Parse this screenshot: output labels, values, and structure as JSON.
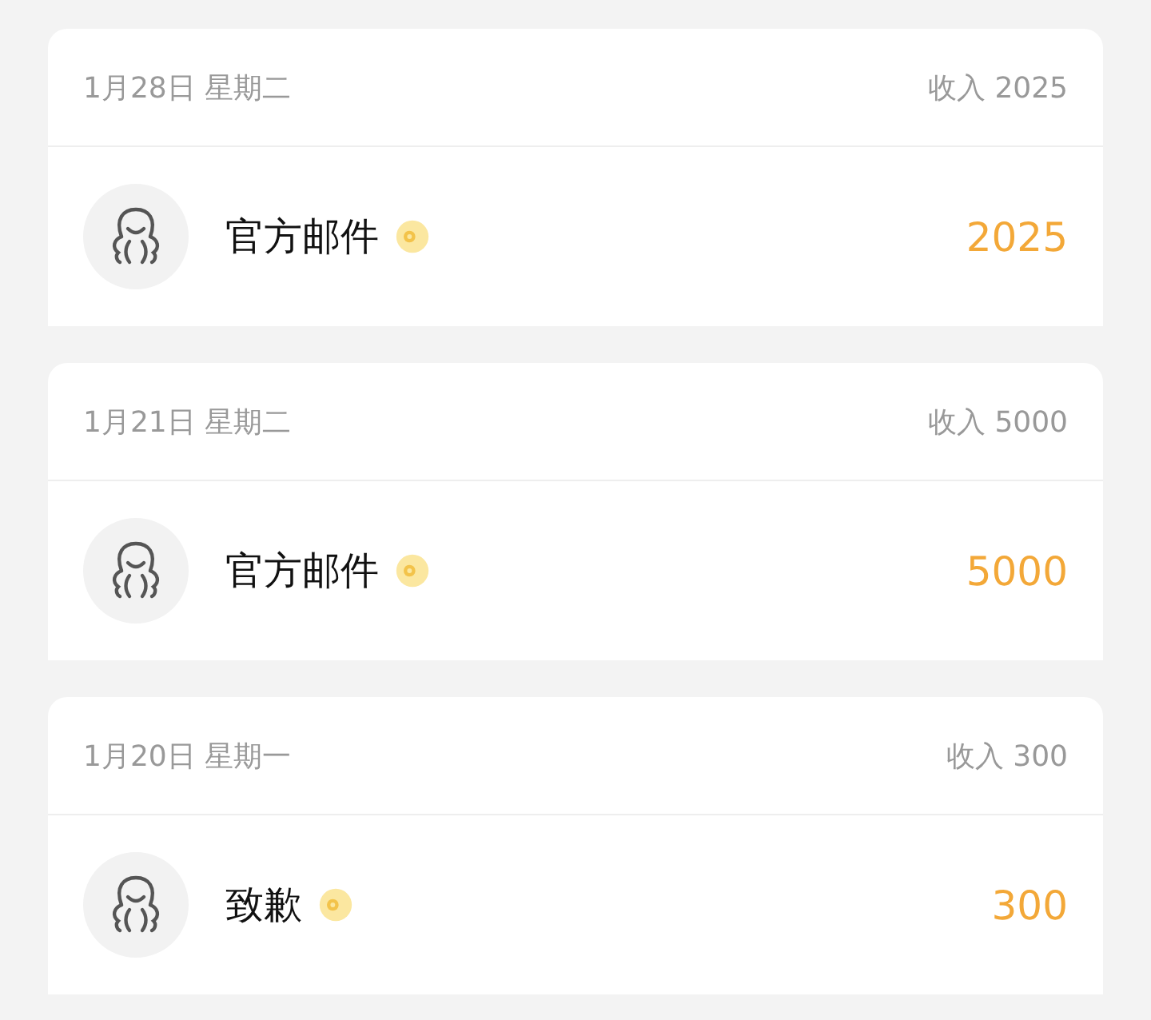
{
  "records": [
    {
      "date": "1月28日 星期二",
      "income": "收入 2025",
      "name": "官方邮件",
      "amount": "2025"
    },
    {
      "date": "1月21日 星期二",
      "income": "收入 5000",
      "name": "官方邮件",
      "amount": "5000"
    },
    {
      "date": "1月20日 星期一",
      "income": "收入 300",
      "name": "致歉",
      "amount": "300"
    }
  ]
}
